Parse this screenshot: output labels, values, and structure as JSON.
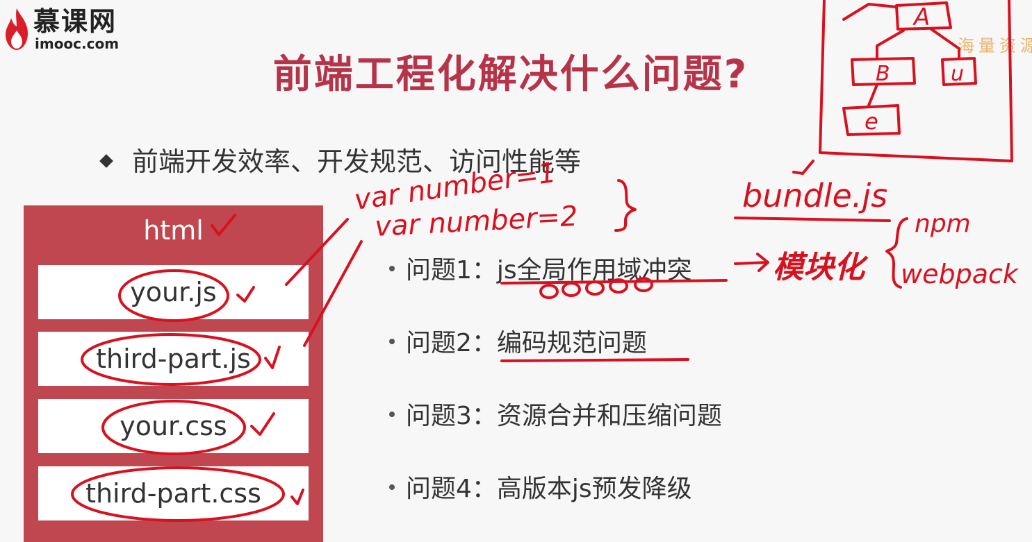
{
  "logo": {
    "cn": "慕课网",
    "en": "imooc.com"
  },
  "title": "前端工程化解决什么问题?",
  "main_point": "前端开发效率、开发规范、访问性能等",
  "html_box": {
    "title": "html",
    "files": [
      "your.js",
      "third-part.js",
      "your.css",
      "third-part.css"
    ]
  },
  "issues": [
    {
      "label": "问题1：",
      "text": "js全局作用域冲突"
    },
    {
      "label": "问题2：",
      "text": "编码规范问题"
    },
    {
      "label": "问题3：",
      "text": "资源合并和压缩问题"
    },
    {
      "label": "问题4：",
      "text": "高版本js预发降级"
    }
  ],
  "watermark": "海量资源",
  "annotations": {
    "var1": "var number=1",
    "var2": "var number=2",
    "bundle": "bundle.js",
    "modular": "模块化",
    "npm": "npm",
    "webpack": "webpack",
    "node_a": "A",
    "node_b": "B",
    "node_u": "u",
    "node_c": "e"
  },
  "colors": {
    "accent": "#b53449",
    "box": "#c0474f",
    "ink": "#d8111f"
  }
}
